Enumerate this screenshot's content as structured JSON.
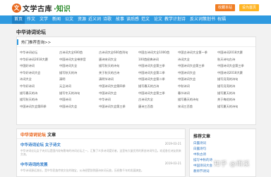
{
  "header": {
    "logo_mark": "文",
    "logo_text": "文学古库",
    "logo_brand": "·知识",
    "fav_button": "收藏本站",
    "home_button": "设为首页"
  },
  "nav": {
    "items": [
      "首页",
      "作文",
      "文学",
      "新闻",
      "公文",
      "资源",
      "近义词",
      "诗歌",
      "故事",
      "读后感",
      "范文",
      "论文",
      "教学计划",
      "诗",
      "反义词",
      "策划书",
      "祝福"
    ],
    "active_index": 0
  },
  "page_title": "中华诗词论坛",
  "hot_panel": {
    "title": "热门推荐查询>>",
    "cells": [
      "中华诗词论坛",
      "古诗词大全600首",
      "古诗词大全600首列句",
      "中国古诗词大全1000首",
      "中国古诗词大全第一季",
      "中国诗词2018大赛",
      "中华好诗词2018大赛",
      "中国诗词大全带拼音",
      "唐诗宋词大全",
      "100首经典诗词",
      "诗词大全",
      "秋天诗句古诗",
      "中国好诗词",
      "中国诗词大全",
      "描写秋天的诗句",
      "中国诗词大会第三季",
      "中国诗词大会第三季",
      "中国诗词大会第三季",
      "中华好诗词大会",
      "描写秋天的诗",
      "关于秋天的古诗",
      "中国诗词大会第二季",
      "中国诗词大会",
      "中国诗词2018大赛",
      "诗词大全",
      "清明",
      "清明节诗词",
      "中国诗词大会第二季",
      "中国诗词大会",
      "描写月亮的诗句",
      "中华好诗词",
      "元旦诗词",
      "中国诗词大会第四季",
      "描写春天的古诗",
      "中秋诗词",
      "描写月亮的诗",
      "描写春天的诗",
      "描写冬天的诗句",
      "中国诗词大会",
      "中国诗词大会第三季",
      "春节诗词",
      "描写夏天的诗",
      "描写秋天的诗",
      "中国诗词",
      "中华诗词",
      "古诗词大全",
      "描写春天的诗句",
      "关于梅花的诗",
      "中国诗词大会第四季",
      "中国诗词大会",
      "中国诗词大会第三季",
      "唐诗三百首",
      "宋词三百首",
      "描写夏天的诗句"
    ]
  },
  "articles_box": {
    "heading_accent": "中华诗词论坛",
    "heading_rest": "文章",
    "articles": [
      {
        "title": "中华诗词论坛 女子诗文",
        "date": "2019-03-21",
        "summary": "中华诗词论坛女子诗文坛是国内较有影响的诗词论坛之一，汇聚了众多诗词爱好者，这里有大量优秀的原创诗词作品，欢迎各位诗友前来交流。"
      },
      {
        "title": "中华诗词的发展",
        "date": "2019-03-21",
        "summary": "中华诗词源远流长，是中华民族传统文化的瑰宝，从诗经楚辞到唐诗宋词元曲，历经数千年的发展演变。"
      }
    ]
  },
  "recommend_box": {
    "title": "推荐文章",
    "items": [
      "白露诗词",
      "白露诗句",
      "中秋古诗",
      "描写中秋的诗",
      "中国诗词大会",
      "教师节诗词"
    ]
  },
  "watermark": "知乎 @雨溪"
}
